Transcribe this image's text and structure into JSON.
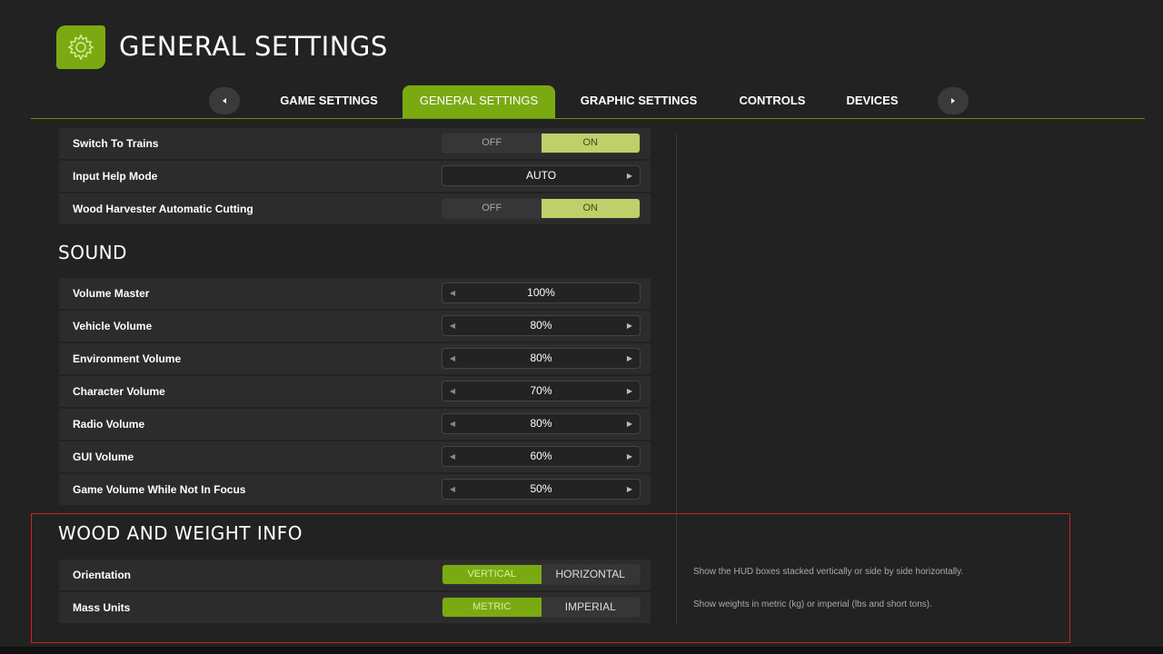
{
  "header": {
    "title": "GENERAL SETTINGS",
    "icon": "gear-icon",
    "accent_color": "#7aaa12"
  },
  "tabs": [
    {
      "label": "GAME SETTINGS",
      "active": false
    },
    {
      "label": "GENERAL SETTINGS",
      "active": true
    },
    {
      "label": "GRAPHIC SETTINGS",
      "active": false
    },
    {
      "label": "CONTROLS",
      "active": false
    },
    {
      "label": "DEVICES",
      "active": false
    }
  ],
  "general_rows": [
    {
      "label": "Switch To Trains",
      "off": "OFF",
      "on": "ON",
      "selected": "ON"
    },
    {
      "label": "Input Help Mode",
      "value": "AUTO"
    },
    {
      "label": "Wood Harvester Automatic Cutting",
      "off": "OFF",
      "on": "ON",
      "selected": "ON"
    }
  ],
  "sound": {
    "title": "SOUND",
    "rows": [
      {
        "label": "Volume Master",
        "value": "100%"
      },
      {
        "label": "Vehicle Volume",
        "value": "80%"
      },
      {
        "label": "Environment Volume",
        "value": "80%"
      },
      {
        "label": "Character Volume",
        "value": "70%"
      },
      {
        "label": "Radio Volume",
        "value": "80%"
      },
      {
        "label": "GUI Volume",
        "value": "60%"
      },
      {
        "label": "Game Volume While Not In Focus",
        "value": "50%"
      }
    ]
  },
  "wood_weight": {
    "title": "WOOD AND WEIGHT INFO",
    "orientation": {
      "label": "Orientation",
      "option_a": "VERTICAL",
      "option_b": "HORIZONTAL",
      "selected": "VERTICAL",
      "description": "Show the HUD boxes stacked vertically or side by side horizontally."
    },
    "mass_units": {
      "label": "Mass Units",
      "option_a": "METRIC",
      "option_b": "IMPERIAL",
      "selected": "METRIC",
      "description": "Show weights in metric (kg) or imperial (lbs and short tons)."
    }
  }
}
